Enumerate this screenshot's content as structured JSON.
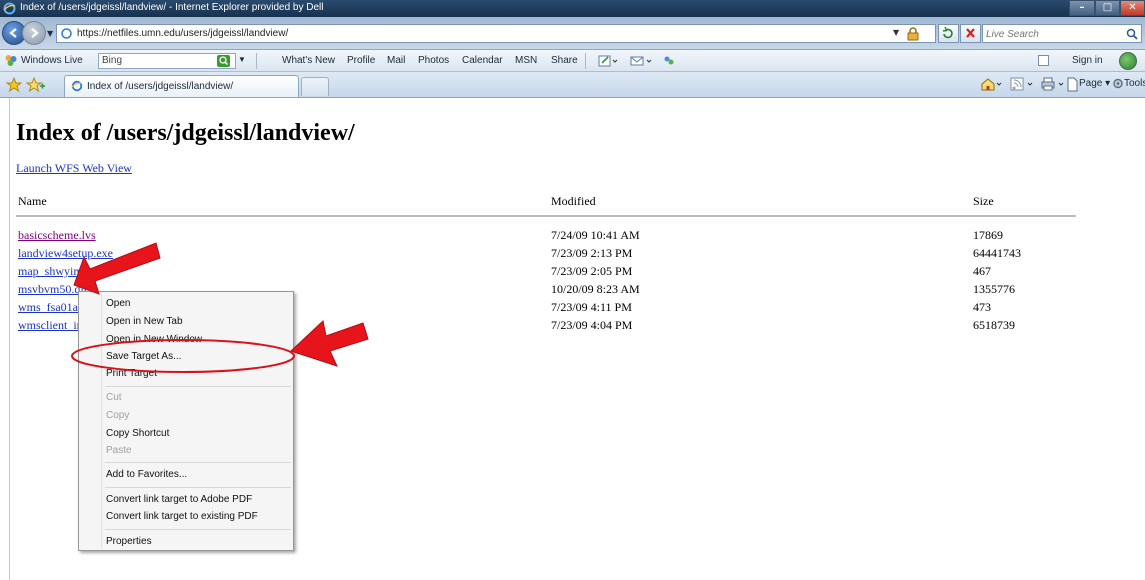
{
  "window": {
    "title": "Index of /users/jdgeissl/landview/ - Internet Explorer provided by Dell",
    "controls": [
      "minimize",
      "maximize",
      "close"
    ]
  },
  "address_bar": {
    "url": "https://netfiles.umn.edu/users/jdgeissl/landview/",
    "search_placeholder": "Live Search"
  },
  "windows_live_toolbar": {
    "label": "Windows Live",
    "search_value": "Bing",
    "links": [
      "What's New",
      "Profile",
      "Mail",
      "Photos",
      "Calendar",
      "MSN",
      "Share"
    ],
    "sign_in": "Sign in"
  },
  "tabs": [
    {
      "title": "Index of /users/jdgeissl/landview/",
      "active": true
    }
  ],
  "command_bar": {
    "page": "Page",
    "tools": "Tools"
  },
  "page": {
    "title": "Index of /users/jdgeissl/landview/",
    "link_launch": "Launch WFS Web View",
    "columns": {
      "name": "Name",
      "modified": "Modified",
      "size": "Size"
    },
    "files": [
      {
        "name": "basicscheme.lvs",
        "modified": "7/24/09 10:41 AM",
        "size": "17869",
        "visited": true
      },
      {
        "name": "landview4setup.exe",
        "modified": "7/23/09 2:13 PM",
        "size": "64441743",
        "visited": false
      },
      {
        "name": "map_shwyim1.og",
        "modified": "7/23/09 2:05 PM",
        "size": "467",
        "visited": false
      },
      {
        "name": "msvbvm50.dll",
        "modified": "10/20/09 8:23 AM",
        "size": "1355776",
        "visited": false
      },
      {
        "name": "wms_fsa01a",
        "modified": "7/23/09 4:11 PM",
        "size": "473",
        "visited": false
      },
      {
        "name": "wmsclient_ir",
        "modified": "7/23/09 4:04 PM",
        "size": "6518739",
        "visited": false
      }
    ]
  },
  "context_menu": {
    "items": [
      {
        "label": "Open",
        "enabled": true
      },
      {
        "label": "Open in New Tab",
        "enabled": true
      },
      {
        "label": "Open in New Window",
        "enabled": true
      },
      {
        "label": "Save Target As...",
        "enabled": true,
        "highlighted": true
      },
      {
        "label": "Print Target",
        "enabled": true
      },
      {
        "label": "Cut",
        "enabled": false
      },
      {
        "label": "Copy",
        "enabled": false
      },
      {
        "label": "Copy Shortcut",
        "enabled": true
      },
      {
        "label": "Paste",
        "enabled": false
      },
      {
        "label": "Add to Favorites...",
        "enabled": true
      },
      {
        "label": "Convert link target to Adobe PDF",
        "enabled": true
      },
      {
        "label": "Convert link target to existing PDF",
        "enabled": true
      },
      {
        "label": "Properties",
        "enabled": true
      }
    ]
  },
  "annotations": {
    "arrow_color": "#e8141b",
    "ellipse_color": "#d8141b"
  }
}
